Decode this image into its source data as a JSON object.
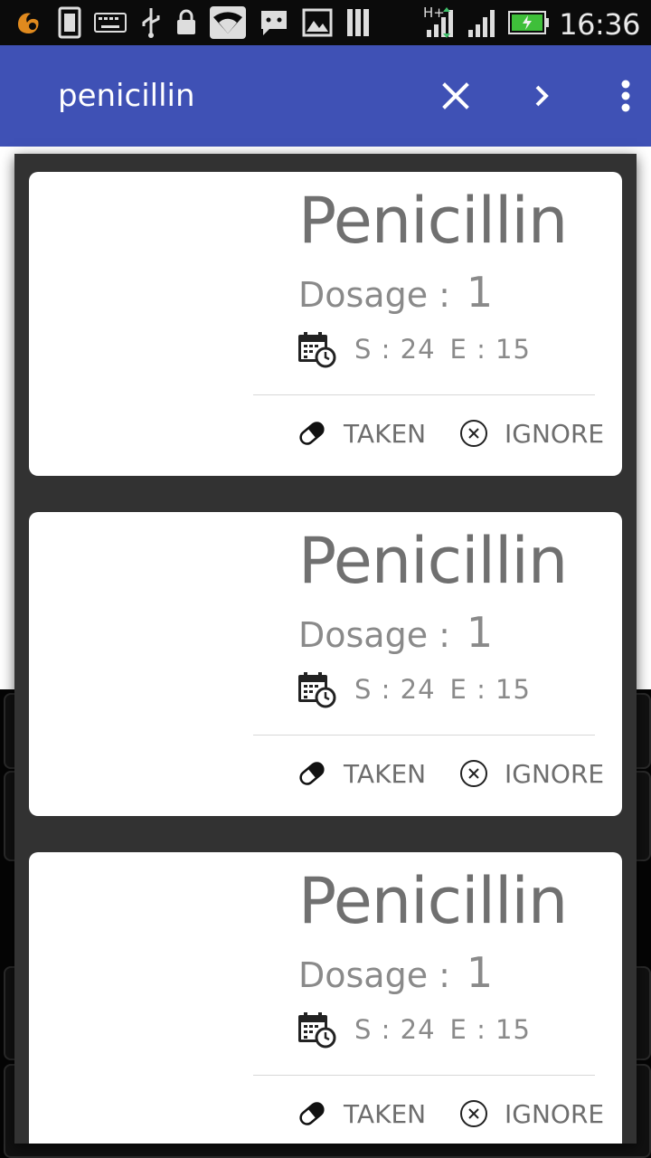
{
  "status_bar": {
    "time": "16:36",
    "network_label": "H+",
    "icons": [
      "uc-browser-icon",
      "sim-icon",
      "keyboard-icon",
      "usb-icon",
      "lock-icon",
      "wifi-icon",
      "chat-icon",
      "image-icon",
      "sd-card-icon",
      "signal-h-plus-icon",
      "signal-icon",
      "battery-charging-icon"
    ]
  },
  "app_bar": {
    "search_text": "penicillin",
    "icons": [
      "close-icon",
      "chevron-right-icon",
      "more-vert-icon"
    ],
    "color": "#3f51b5"
  },
  "cards": [
    {
      "title": "Penicillin",
      "dosage_label": "Dosage",
      "dosage_colon": ":",
      "dosage_value": "1",
      "start": "S : 24",
      "end": "E : 15",
      "taken_label": "TAKEN",
      "ignore_label": "IGNORE"
    },
    {
      "title": "Penicillin",
      "dosage_label": "Dosage",
      "dosage_colon": ":",
      "dosage_value": "1",
      "start": "S : 24",
      "end": "E : 15",
      "taken_label": "TAKEN",
      "ignore_label": "IGNORE"
    },
    {
      "title": "Penicillin",
      "dosage_label": "Dosage",
      "dosage_colon": ":",
      "dosage_value": "1",
      "start": "S : 24",
      "end": "E : 15",
      "taken_label": "TAKEN",
      "ignore_label": "IGNORE"
    }
  ],
  "colors": {
    "dialog_bg": "#323232",
    "card_bg": "#ffffff",
    "text_gray": "#707070"
  }
}
